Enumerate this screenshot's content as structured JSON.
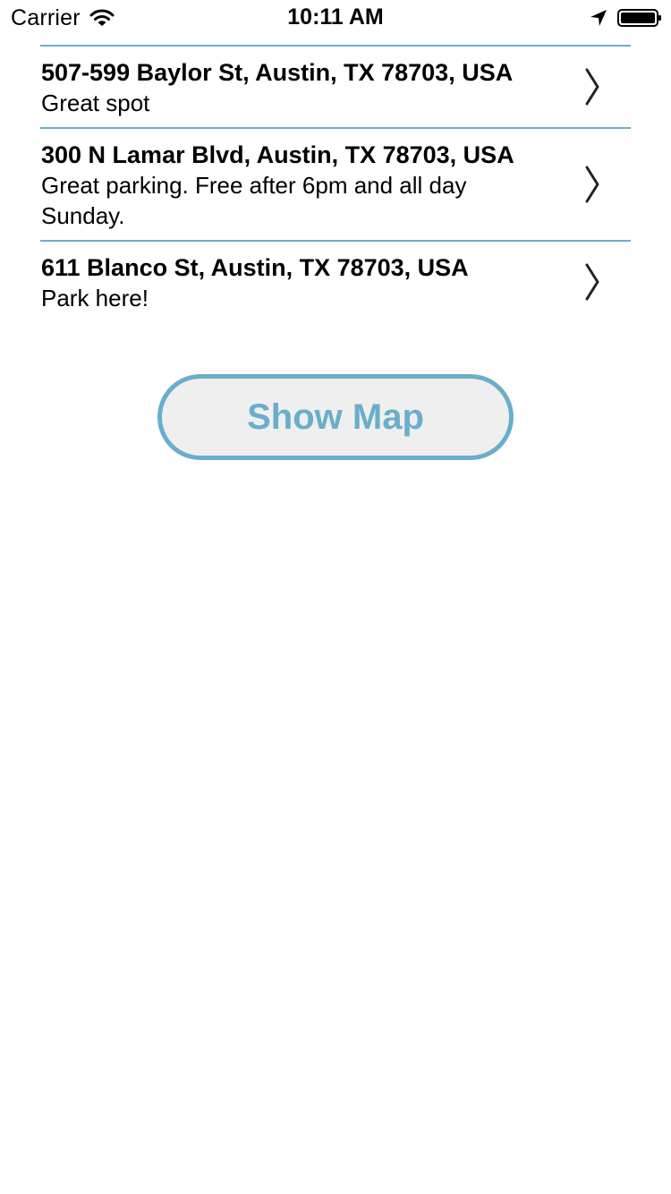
{
  "status_bar": {
    "carrier": "Carrier",
    "time": "10:11 AM",
    "icons": [
      "wifi-icon",
      "location-arrow-icon",
      "battery-icon"
    ]
  },
  "parking_list": {
    "divider_color": "#6aaecb",
    "items": [
      {
        "address": "507-599 Baylor St, Austin, TX 78703, USA",
        "note": "Great spot"
      },
      {
        "address": "300 N Lamar Blvd, Austin, TX 78703, USA",
        "note": "Great parking. Free after 6pm and all day Sunday."
      },
      {
        "address": "611 Blanco St, Austin, TX 78703, USA",
        "note": "Park here!"
      }
    ]
  },
  "show_map_button": {
    "label": "Show Map",
    "accent_color": "#6aaecb",
    "background_color": "#efefef"
  }
}
